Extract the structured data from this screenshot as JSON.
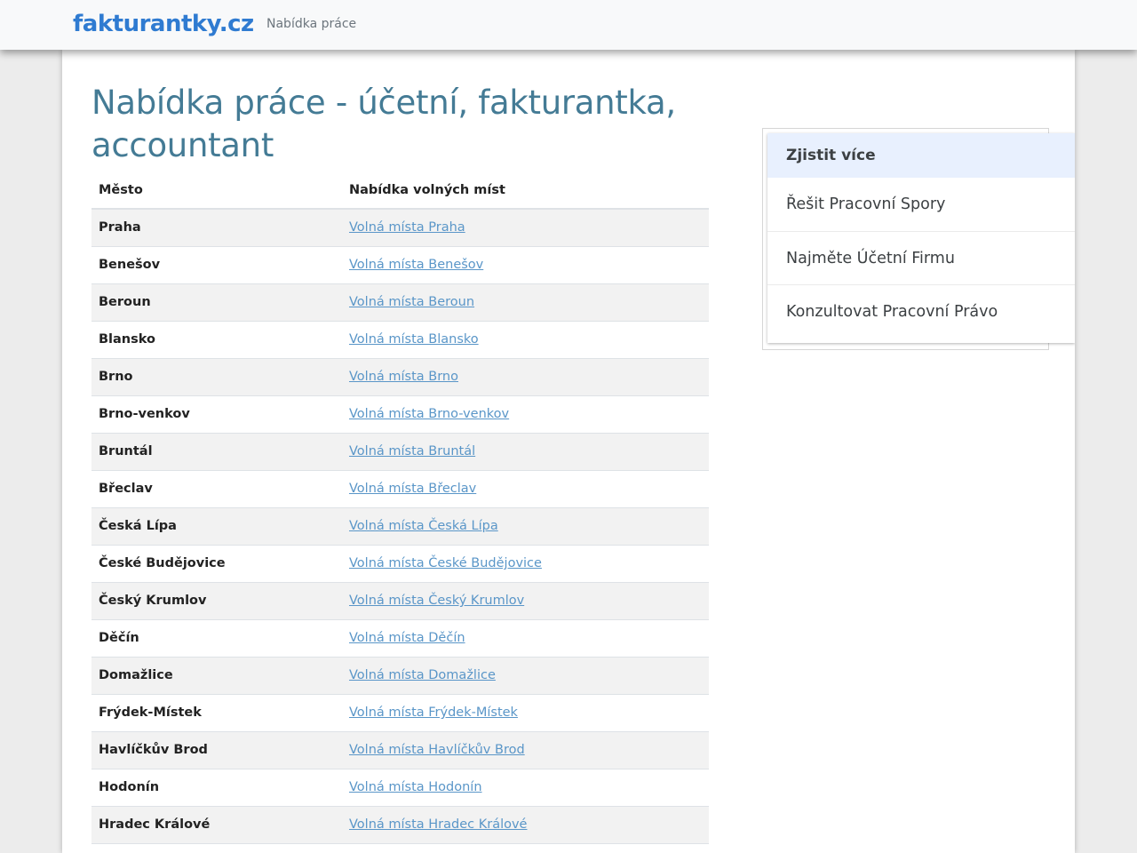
{
  "header": {
    "brand": "fakturantky.cz",
    "nav_link": "Nabídka práce"
  },
  "main": {
    "title": "Nabídka práce - účetní, fakturantka, accountant",
    "table": {
      "columns": [
        "Město",
        "Nabídka volných míst"
      ],
      "rows": [
        {
          "city": "Praha",
          "link": "Volná místa Praha"
        },
        {
          "city": "Benešov",
          "link": "Volná místa Benešov"
        },
        {
          "city": "Beroun",
          "link": "Volná místa Beroun"
        },
        {
          "city": "Blansko",
          "link": "Volná místa Blansko"
        },
        {
          "city": "Brno",
          "link": "Volná místa Brno"
        },
        {
          "city": "Brno-venkov",
          "link": "Volná místa Brno-venkov"
        },
        {
          "city": "Bruntál",
          "link": "Volná místa Bruntál"
        },
        {
          "city": "Břeclav",
          "link": "Volná místa Břeclav"
        },
        {
          "city": "Česká Lípa",
          "link": "Volná místa Česká Lípa"
        },
        {
          "city": "České Budějovice",
          "link": "Volná místa České Budějovice"
        },
        {
          "city": "Český Krumlov",
          "link": "Volná místa Český Krumlov"
        },
        {
          "city": "Děčín",
          "link": "Volná místa Děčín"
        },
        {
          "city": "Domažlice",
          "link": "Volná místa Domažlice"
        },
        {
          "city": "Frýdek-Místek",
          "link": "Volná místa Frýdek-Místek"
        },
        {
          "city": "Havlíčkův Brod",
          "link": "Volná místa Havlíčkův Brod"
        },
        {
          "city": "Hodonín",
          "link": "Volná místa Hodonín"
        },
        {
          "city": "Hradec Králové",
          "link": "Volná místa Hradec Králové"
        }
      ]
    }
  },
  "ad": {
    "header": "Zjistit více",
    "items": [
      "Řešit Pracovní Spory",
      "Najměte Účetní Firmu",
      "Konzultovat Pracovní Právo"
    ]
  },
  "colors": {
    "brand": "#2f7bd1",
    "title": "#447b95",
    "link": "#5a96c8",
    "ad_header_bg": "#e8f0fe"
  }
}
